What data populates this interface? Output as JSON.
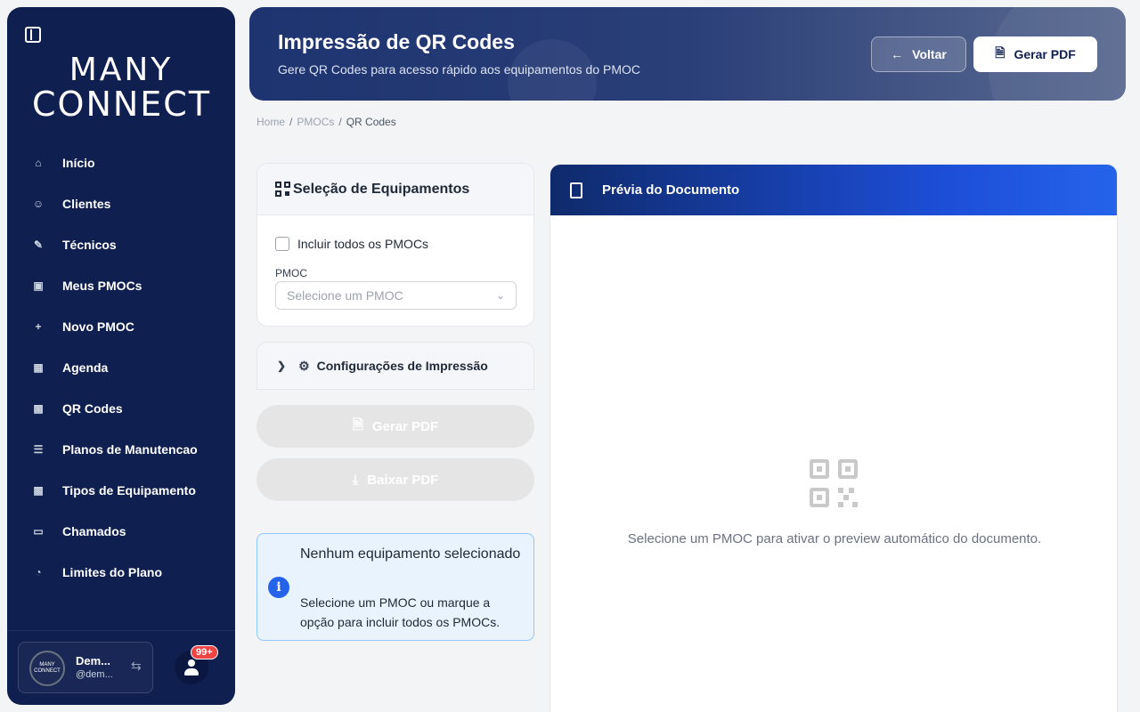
{
  "sidebar": {
    "logo_line1": "MANY",
    "logo_line2": "CONNECT",
    "items": [
      {
        "label": "Início",
        "icon": "home-icon"
      },
      {
        "label": "Clientes",
        "icon": "users-icon"
      },
      {
        "label": "Técnicos",
        "icon": "wrench-icon"
      },
      {
        "label": "Meus PMOCs",
        "icon": "clipboard-icon"
      },
      {
        "label": "Novo PMOC",
        "icon": "plus-icon"
      },
      {
        "label": "Agenda",
        "icon": "calendar-icon"
      },
      {
        "label": "QR Codes",
        "icon": "qr-icon"
      },
      {
        "label": "Planos de Manutencao",
        "icon": "list-icon"
      },
      {
        "label": "Tipos de Equipamento",
        "icon": "grid-icon"
      },
      {
        "label": "Chamados",
        "icon": "ticket-icon"
      },
      {
        "label": "Limites do Plano",
        "icon": "gauge-icon"
      }
    ],
    "user": {
      "name": "Dem...",
      "handle": "@dem...",
      "avatar_text": "MANY CONNECT"
    },
    "notification_badge": "99+"
  },
  "header": {
    "title": "Impressão de QR Codes",
    "subtitle": "Gere QR Codes para acesso rápido aos equipamentos do PMOC",
    "back_label": "Voltar",
    "generate_label": "Gerar PDF"
  },
  "breadcrumb": {
    "home": "Home",
    "pmocs": "PMOCs",
    "current": "QR Codes"
  },
  "selection": {
    "title": "Seleção de Equipamentos",
    "include_all_label": "Incluir todos os PMOCs",
    "pmoc_label": "PMOC",
    "pmoc_placeholder": "Selecione um PMOC"
  },
  "config": {
    "title": "Configurações de Impressão"
  },
  "actions": {
    "generate_pdf": "Gerar PDF",
    "download_pdf": "Baixar PDF"
  },
  "info": {
    "title": "Nenhum equipamento selecionado",
    "description": "Selecione um PMOC ou marque a opção para incluir todos os PMOCs."
  },
  "preview": {
    "title": "Prévia do Documento",
    "empty_message": "Selecione um PMOC para ativar o preview automático do documento."
  }
}
